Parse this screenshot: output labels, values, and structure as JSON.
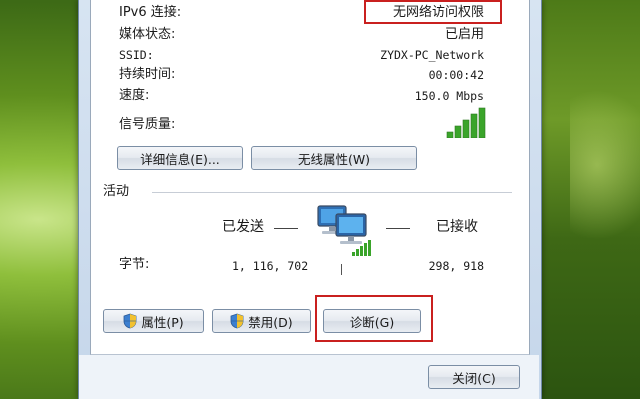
{
  "status_rows": [
    {
      "label": "IPv6 连接:",
      "value": "无网络访问权限"
    },
    {
      "label": "媒体状态:",
      "value": "已启用"
    },
    {
      "label": "SSID:",
      "value": "ZYDX-PC_Network"
    },
    {
      "label": "持续时间:",
      "value": "00:00:42"
    },
    {
      "label": "速度:",
      "value": "150.0 Mbps"
    }
  ],
  "signal": {
    "label": "信号质量:",
    "bars_lit": 5,
    "bars_total": 5
  },
  "buttons": {
    "details": "详细信息(E)...",
    "wireless_properties": "无线属性(W)",
    "properties": "属性(P)",
    "disable": "禁用(D)",
    "diagnose": "诊断(G)",
    "close": "关闭(C)"
  },
  "activity": {
    "section_title": "活动",
    "sent_label": "已发送",
    "received_label": "已接收",
    "bytes_label": "字节:",
    "bytes_sent": "1, 116, 702",
    "bytes_received": "298, 918"
  },
  "colors": {
    "highlight": "#c9201f",
    "signal_green": "#3aa42a",
    "panel_border": "#9aa9bb"
  }
}
